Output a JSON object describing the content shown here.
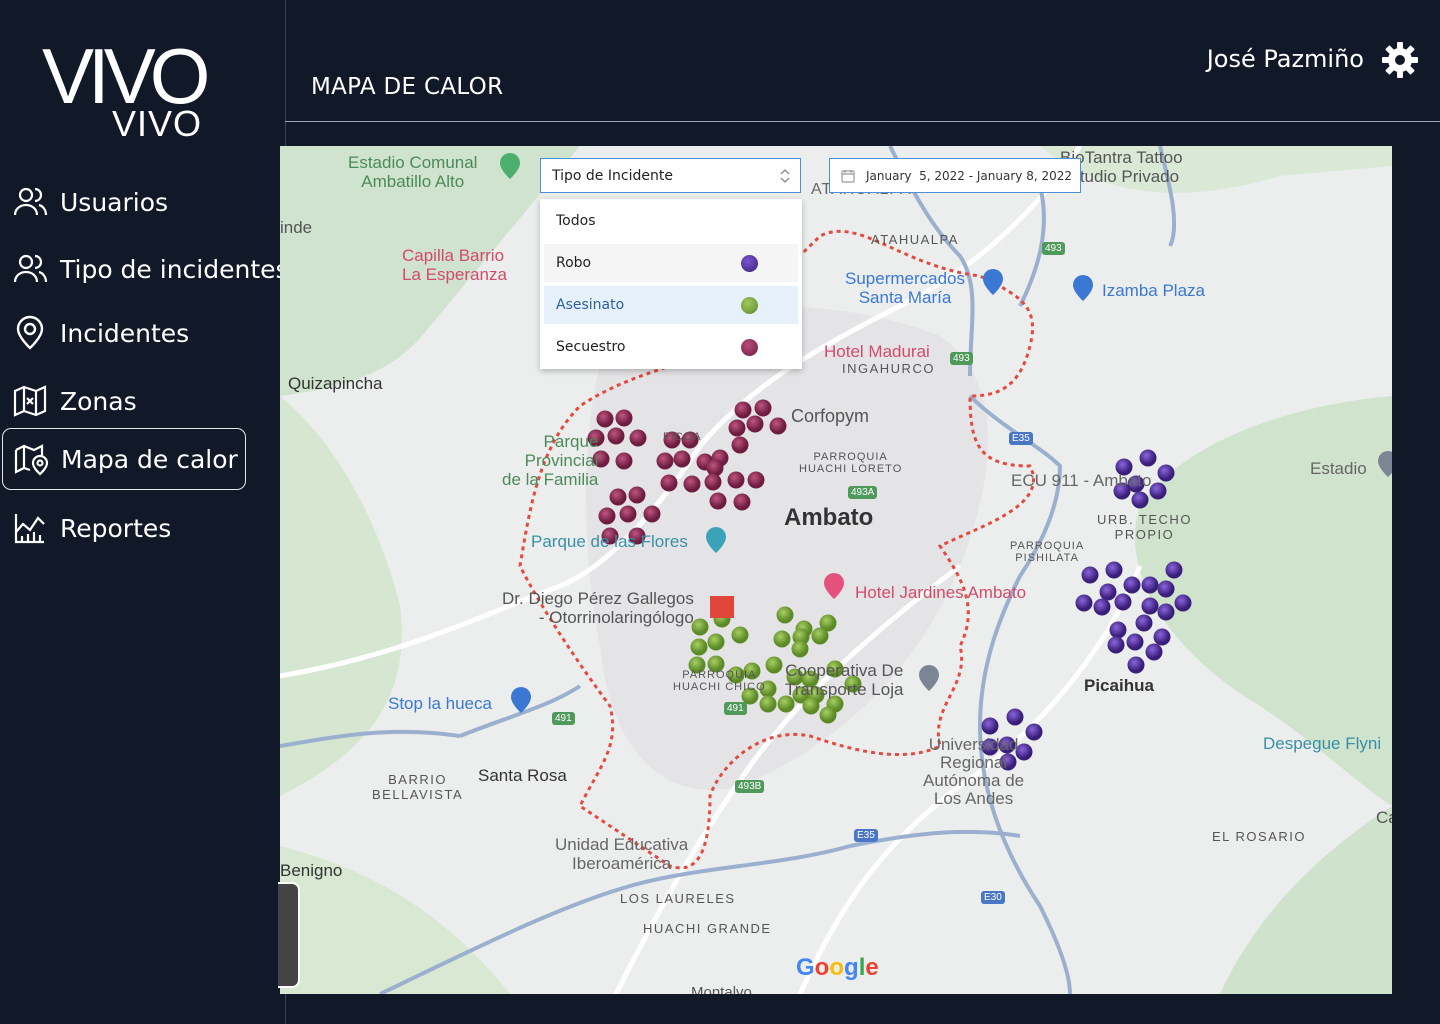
{
  "brand": {
    "logo_top": "VIVO",
    "logo_bottom": "VIVO"
  },
  "sidebar": {
    "items": [
      {
        "label": "Usuarios",
        "icon": "users-icon"
      },
      {
        "label": "Tipo de incidentes",
        "icon": "users-icon"
      },
      {
        "label": "Incidentes",
        "icon": "location-pin-icon"
      },
      {
        "label": "Zonas",
        "icon": "map-zone-icon"
      },
      {
        "label": "Mapa de calor",
        "icon": "map-pin-icon",
        "active": true
      },
      {
        "label": "Reportes",
        "icon": "chart-icon"
      }
    ]
  },
  "header": {
    "title": "MAPA DE CALOR",
    "user_name": "José Pazmiño",
    "settings_icon": "gear-icon"
  },
  "filters": {
    "incident_type": {
      "selected": "Tipo de Incidente"
    },
    "date_range": {
      "value": "January  5, 2022 - January 8, 2022"
    }
  },
  "incident_menu": {
    "options": [
      {
        "label": "Todos",
        "color": null
      },
      {
        "label": "Robo",
        "color": "#5b34a8"
      },
      {
        "label": "Asesinato",
        "color": "#7aa83a"
      },
      {
        "label": "Secuestro",
        "color": "#8e2d58"
      }
    ]
  },
  "colors": {
    "robo": "#6a3cc4",
    "asesinato": "#7fb13a",
    "secuestro": "#9b2f5e",
    "sidebar_bg": "#111827",
    "accent": "#4b8fd6"
  },
  "map": {
    "labels": {
      "estadio": "Estadio Comunal\nAmbatillo Alto",
      "tattoo": "BioTantra Tattoo\nEstudio Privado",
      "capilla": "Capilla Barrio\nLa Esperanza",
      "atahualpa_top": "ATAHUALPA",
      "atahualpa": "ATAHUALPA",
      "supermercados": "Supermercados\nSanta María",
      "izamba": "Izamba Plaza",
      "hotel_madurai": "Hotel Madurai",
      "ingahurco": "INGAHURCO",
      "quizapincha": "Quizapincha",
      "corfopym": "Corfopym",
      "parque_familia": "Parque\nProvincial\nde la Familia",
      "parroquia_huachi_loreto": "PARROQUIA\nHUACHI LORETO",
      "ficoa": "FICOA",
      "ambato": "Ambato",
      "ecu911": "ECU 911 - Ambato",
      "urb_techo": "URB. TECHO\nPROPIO",
      "estadio_right": "Estadio",
      "parque_flores": "Parque de las Flores",
      "parroquia_pishilata": "PARROQUIA\nPISHILATA",
      "hotel_jardines": "Hotel Jardines Ambato",
      "diego": "Dr. Diego Pérez Gallegos\n- Otorrinolaringólogo",
      "cooperativa": "Cooperativa De\nTransporte Loja",
      "parroquia_huachi_chico": "PARROQUIA\nHUACHI CHICO",
      "picaihua": "Picaihua",
      "stop_hueca": "Stop la hueca",
      "universidad": "Universidad\nRegional\nAutónoma de\nLos Andes",
      "despegue": "Despegue Flyni",
      "barrio_bellavista": "BARRIO\nBELLAVISTA",
      "santa_rosa": "Santa Rosa",
      "el_rosario": "EL ROSARIO",
      "unidad_educativa": "Unidad Educativa\nIberoamérica",
      "los_laureles": "LOS LAURELES",
      "huachi_grande": "HUACHI GRANDE",
      "benigno": "Benigno",
      "montalvo": "Montalvo",
      "inde": "inde",
      "ca": "Ca",
      "google": "Google",
      "shield_493": "493",
      "shield_493a": "493A",
      "shield_491": "491",
      "shield_493b": "493B",
      "shield_e35": "E35",
      "shield_e30": "E30"
    }
  }
}
